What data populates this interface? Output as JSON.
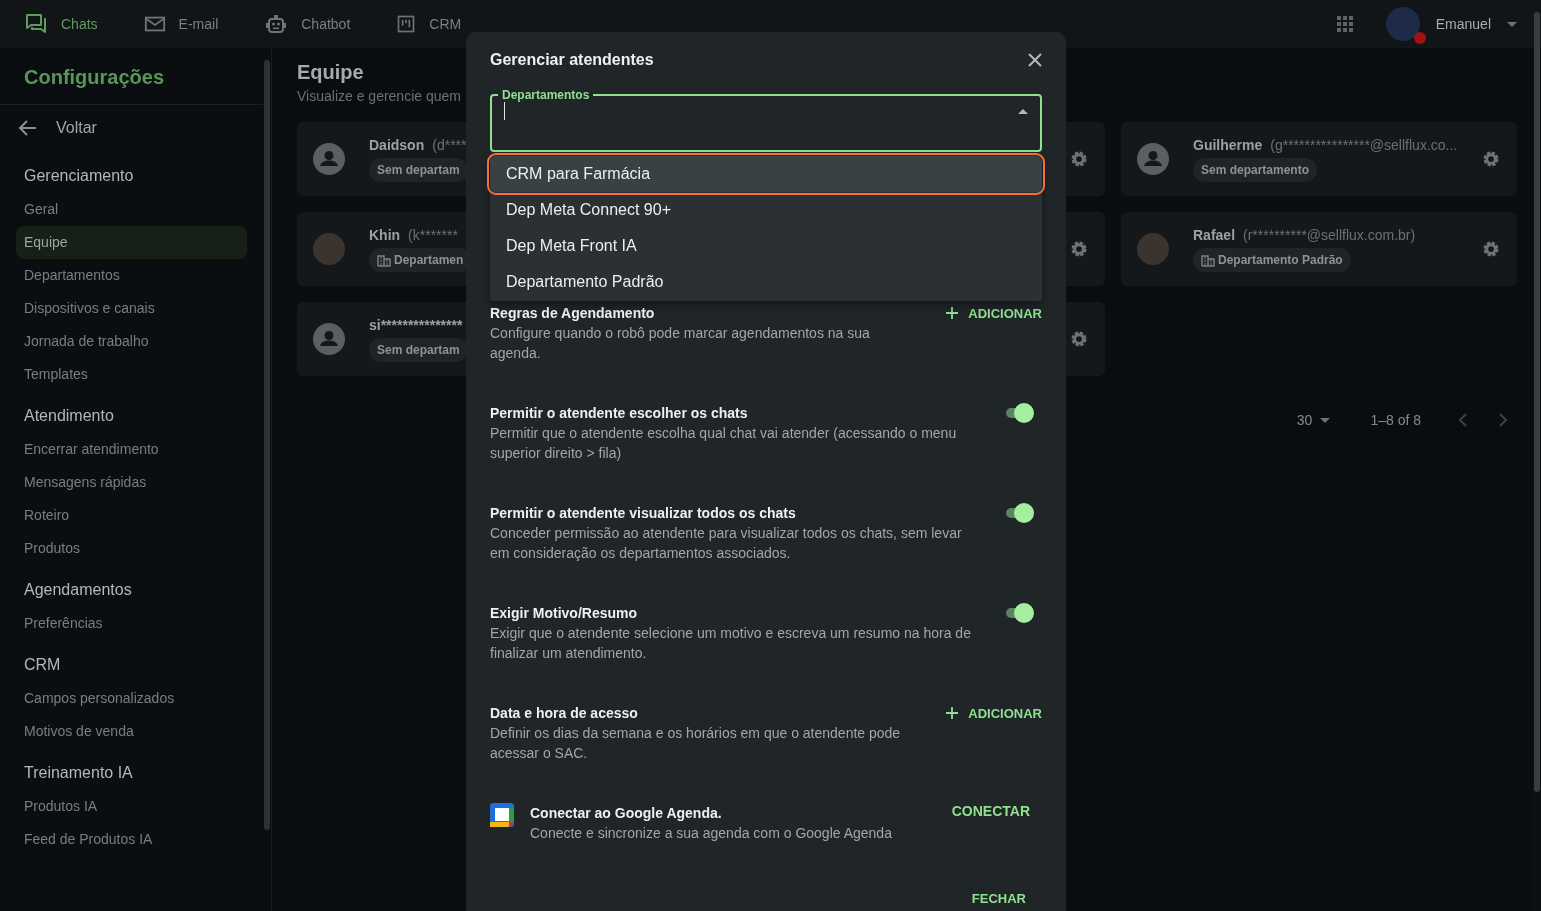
{
  "top_nav": {
    "tabs": [
      {
        "label": "Chats",
        "selected": true
      },
      {
        "label": "E-mail",
        "selected": false
      },
      {
        "label": "Chatbot",
        "selected": false
      },
      {
        "label": "CRM",
        "selected": false
      }
    ],
    "user": {
      "name": "Emanuel"
    }
  },
  "sidebar": {
    "title": "Configurações",
    "back": "Voltar",
    "sections": [
      {
        "heading": "Gerenciamento",
        "items": [
          {
            "label": "Geral",
            "selected": false
          },
          {
            "label": "Equipe",
            "selected": true
          },
          {
            "label": "Departamentos",
            "selected": false
          },
          {
            "label": "Dispositivos e canais",
            "selected": false
          },
          {
            "label": "Jornada de trabalho",
            "selected": false
          },
          {
            "label": "Templates",
            "selected": false
          }
        ]
      },
      {
        "heading": "Atendimento",
        "items": [
          {
            "label": "Encerrar atendimento",
            "selected": false
          },
          {
            "label": "Mensagens rápidas",
            "selected": false
          },
          {
            "label": "Roteiro",
            "selected": false
          },
          {
            "label": "Produtos",
            "selected": false
          }
        ]
      },
      {
        "heading": "Agendamentos",
        "items": [
          {
            "label": "Preferências",
            "selected": false
          }
        ]
      },
      {
        "heading": "CRM",
        "items": [
          {
            "label": "Campos personalizados",
            "selected": false
          },
          {
            "label": "Motivos de venda",
            "selected": false
          }
        ]
      },
      {
        "heading": "Treinamento IA",
        "items": [
          {
            "label": "Produtos IA",
            "selected": false
          },
          {
            "label": "Feed de Produtos IA",
            "selected": false
          }
        ]
      }
    ]
  },
  "main": {
    "title": "Equipe",
    "subtitle": "Visualize e gerencie quem",
    "member_rows": [
      [
        {
          "kind": "member",
          "name": "Daidson",
          "email": "(d****",
          "department": "Sem departam",
          "has_department": false,
          "photo": false
        },
        {
          "kind": "covered"
        },
        {
          "kind": "member",
          "name": "Guilherme",
          "email": "(g****************@sellflux.co...",
          "department": "Sem departamento",
          "has_department": false,
          "photo": false
        }
      ],
      [
        {
          "kind": "member",
          "name": "Khin",
          "email": "(k*******",
          "department": "Departamen",
          "has_department": true,
          "photo": true
        },
        {
          "kind": "covered"
        },
        {
          "kind": "member",
          "name": "Rafael",
          "email": "(r**********@sellflux.com.br)",
          "department": "Departamento Padrão",
          "has_department": true,
          "photo": true
        }
      ],
      [
        {
          "kind": "member",
          "name": "si***************",
          "department": "Sem departam",
          "has_department": false,
          "photo": false
        },
        {
          "kind": "covered"
        }
      ]
    ],
    "pagination": {
      "rows_per_page": "30",
      "range": "1–8 of 8"
    }
  },
  "dialog": {
    "title": "Gerenciar atendentes",
    "department_field": {
      "label": "Departamentos",
      "expanded": true,
      "options": [
        {
          "label": "CRM para Farmácia",
          "selected": true
        },
        {
          "label": "Dep Meta Connect 90+",
          "selected": false
        },
        {
          "label": "Dep Meta Front IA",
          "selected": false
        },
        {
          "label": "Departamento Padrão",
          "selected": false
        }
      ]
    },
    "settings": [
      {
        "kind": "action",
        "title": "Regras de Agendamento",
        "description": "Configure quando o robô pode marcar agendamentos na sua agenda.",
        "action": "ADICIONAR"
      },
      {
        "kind": "toggle",
        "title": "Permitir o atendente escolher os chats",
        "description": "Permitir que o atendente escolha qual chat vai atender (acessando o menu superior direito > fila)",
        "on": true
      },
      {
        "kind": "toggle",
        "title": "Permitir o atendente visualizar todos os chats",
        "description": "Conceder permissão ao atendente para visualizar todos os chats, sem levar em consideração os departamentos associados.",
        "on": true
      },
      {
        "kind": "toggle",
        "title": "Exigir Motivo/Resumo",
        "description": "Exigir que o atendente selecione um motivo e escreva um resumo na hora de finalizar um atendimento.",
        "on": true
      },
      {
        "kind": "action",
        "title": "Data e hora de acesso",
        "description": "Definir os dias da semana e os horários em que o atendente pode acessar o SAC.",
        "action": "ADICIONAR"
      },
      {
        "kind": "connect",
        "title": "Conectar ao Google Agenda.",
        "description": "Conecte e sincronize a sua agenda com o Google Agenda",
        "action": "CONECTAR"
      }
    ],
    "close": "FECHAR"
  }
}
